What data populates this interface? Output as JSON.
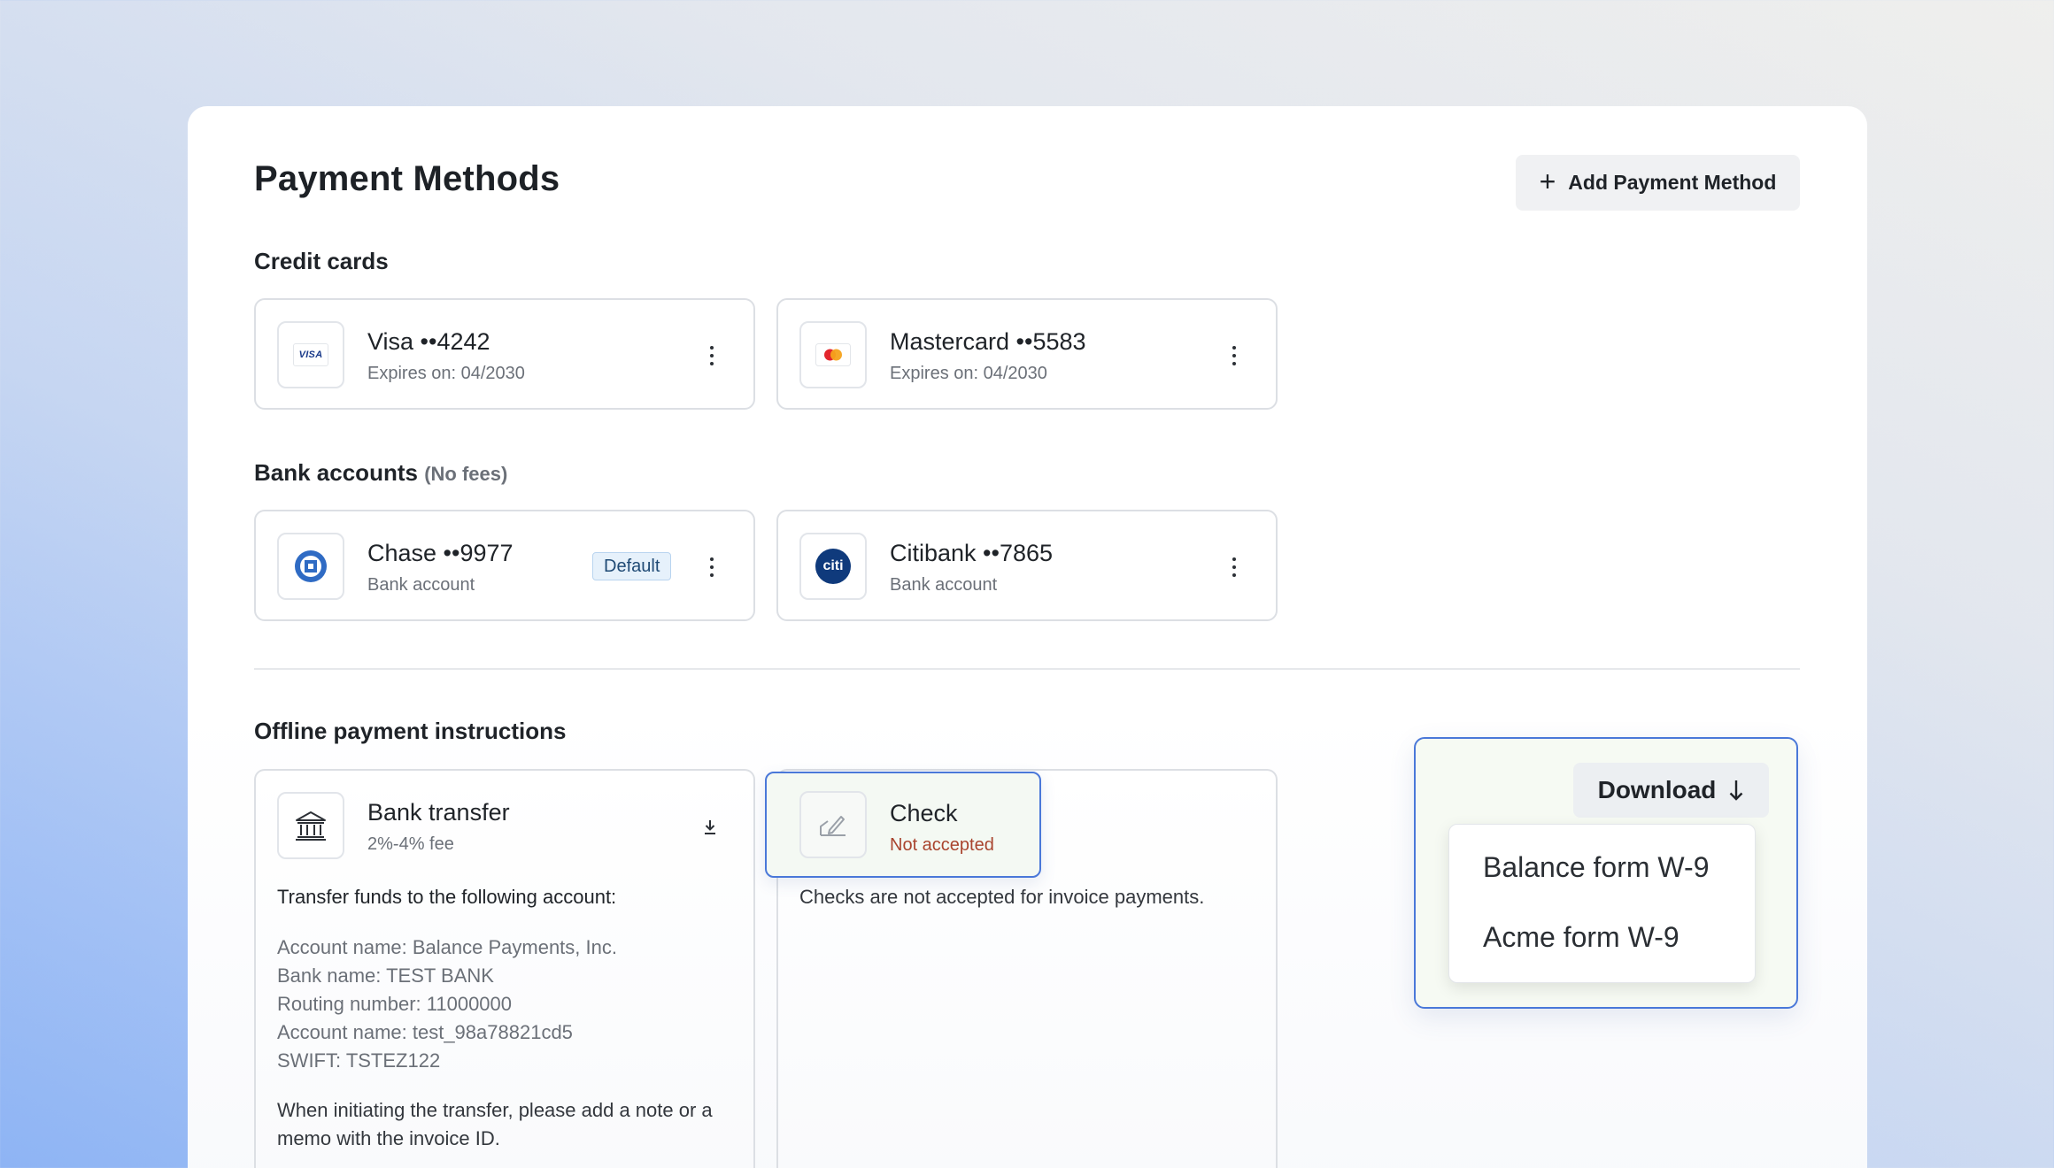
{
  "page": {
    "title": "Payment Methods",
    "add_button_label": "Add Payment Method"
  },
  "credit_cards": {
    "heading": "Credit cards",
    "items": [
      {
        "name": "Visa ••4242",
        "sub": "Expires on: 04/2030",
        "logo": "VISA",
        "icon": "visa-logo"
      },
      {
        "name": "Mastercard ••5583",
        "sub": "Expires on: 04/2030",
        "icon": "mastercard-logo"
      }
    ]
  },
  "bank_accounts": {
    "heading": "Bank accounts",
    "heading_note": "(No fees)",
    "items": [
      {
        "name": "Chase ••9977",
        "sub": "Bank account",
        "badge": "Default",
        "icon": "chase-logo"
      },
      {
        "name": "Citibank ••7865",
        "sub": "Bank account",
        "logo": "citi",
        "icon": "citi-logo"
      }
    ]
  },
  "offline": {
    "heading": "Offline payment instructions",
    "bank_transfer": {
      "name": "Bank transfer",
      "sub": "2%-4% fee",
      "intro": "Transfer funds to the following account:",
      "lines": [
        "Account name: Balance Payments, Inc.",
        "Bank name: TEST BANK",
        "Routing number: 11000000",
        "Account name: test_98a78821cd5",
        "SWIFT: TSTEZ122"
      ],
      "note": "When initiating the transfer, please add a note or a memo with the invoice ID."
    },
    "check": {
      "name": "Check",
      "sub": "Not accepted",
      "note": "Checks are not accepted for invoice payments."
    }
  },
  "download": {
    "label": "Download",
    "options": [
      "Balance form W-9",
      "Acme form W-9"
    ]
  },
  "colors": {
    "accent_outline": "#4a78d9",
    "not_accepted": "#a9442e",
    "default_badge_bg": "#e6f1fb",
    "citi_blue": "#0f3a7c",
    "chase_blue": "#2f6bc4"
  }
}
